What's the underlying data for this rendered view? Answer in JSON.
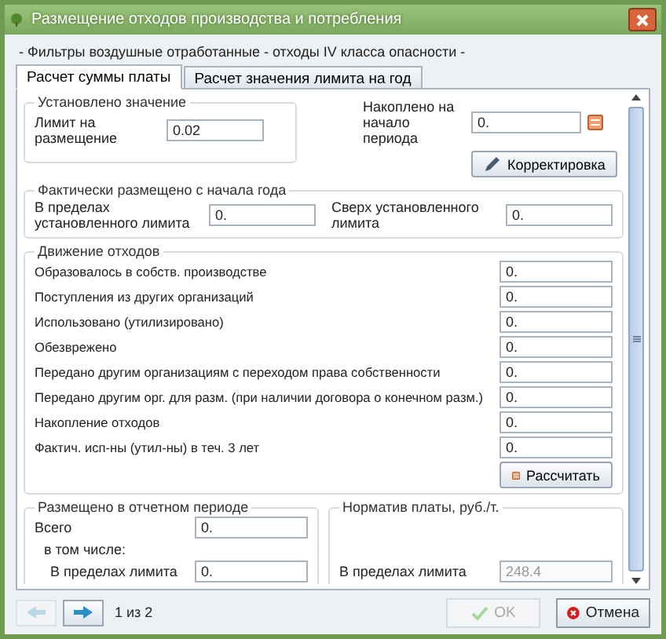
{
  "window": {
    "title": "Размещение отходов производства и потребления"
  },
  "subtitle": "- Фильтры воздушные отработанные - отходы IV класса опасности -",
  "tabs": [
    {
      "label": "Расчет суммы платы",
      "selected": true
    },
    {
      "label": "Расчет значения лимита на год",
      "selected": false
    }
  ],
  "limit_group": {
    "title": "Установлено значение",
    "label": "Лимит на размещение",
    "value": "0.02"
  },
  "accumulated": {
    "label": "Накоплено на начало периода",
    "value": "0.",
    "button": "Корректировка"
  },
  "actual_group": {
    "title": "Фактически размещено с начала года",
    "fields": [
      {
        "label": "В пределах установленного лимита",
        "value": "0."
      },
      {
        "label": "Сверх установленного лимита",
        "value": "0."
      }
    ]
  },
  "movement_group": {
    "title": "Движение отходов",
    "button": "Рассчитать",
    "rows": [
      {
        "label": "Образовалось в собств. производстве",
        "value": "0."
      },
      {
        "label": "Поступления из других организаций",
        "value": "0."
      },
      {
        "label": "Использовано (утилизировано)",
        "value": "0."
      },
      {
        "label": "Обезврежено",
        "value": "0."
      },
      {
        "label": "Передано другим организациям с переходом права собственности",
        "value": "0."
      },
      {
        "label": "Передано другим орг. для разм. (при наличии договора о конечном разм.)",
        "value": "0."
      },
      {
        "label": "Накопление отходов",
        "value": "0."
      },
      {
        "label": "Фактич. исп-ны (утил-ны) в теч. 3 лет",
        "value": "0."
      }
    ]
  },
  "period_group": {
    "title": "Размещено в отчетном периоде",
    "total_label": "Всего",
    "total_value": "0.",
    "including": "в том числе:",
    "rows": [
      {
        "label": "В пределах лимита",
        "value": "0."
      }
    ]
  },
  "rate_group": {
    "title": "Норматив платы, руб./т.",
    "rows": [
      {
        "label": "В пределах лимита",
        "value": "248.4",
        "disabled": true
      }
    ]
  },
  "pager": {
    "text": "1 из 2",
    "prev_disabled": true,
    "next_disabled": false
  },
  "buttons": [
    {
      "kind": "ok",
      "label": "OK",
      "disabled": true
    },
    {
      "kind": "cancel",
      "label": "Отмена",
      "disabled": false
    }
  ]
}
